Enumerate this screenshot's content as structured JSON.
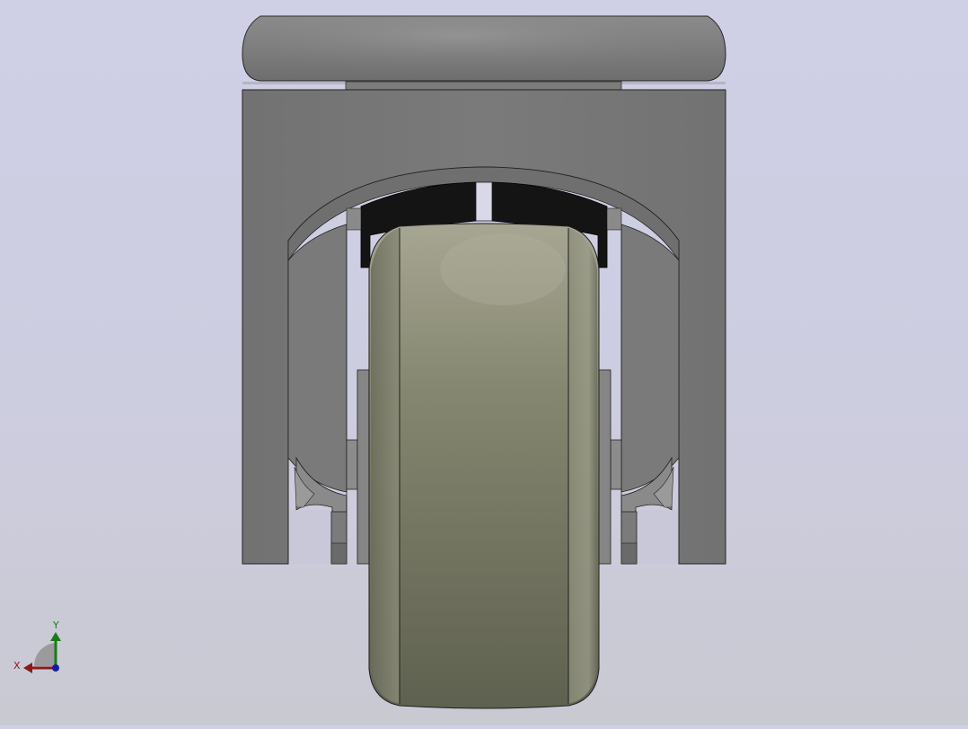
{
  "viewport": {
    "background_top": "#cfcfe6",
    "background_bottom": "#c9c9d2"
  },
  "model": {
    "parts": [
      "top-plate",
      "fork-body",
      "arch-bracket",
      "wheel",
      "axle-hubs"
    ],
    "colors": {
      "metal": "#767676",
      "metal_light": "#8e8e8e",
      "metal_dark": "#5f5f5f",
      "bracket_black": "#151515",
      "tire": "#8b8b76",
      "tire_highlight": "#a8a893",
      "tire_shadow": "#5f6150",
      "edge": "#1e1e1e"
    }
  },
  "triad": {
    "x_label": "X",
    "y_label": "Y",
    "x_color": "#8b1a1a",
    "y_color": "#1a7a1a",
    "z_color": "#1a1aa0"
  }
}
